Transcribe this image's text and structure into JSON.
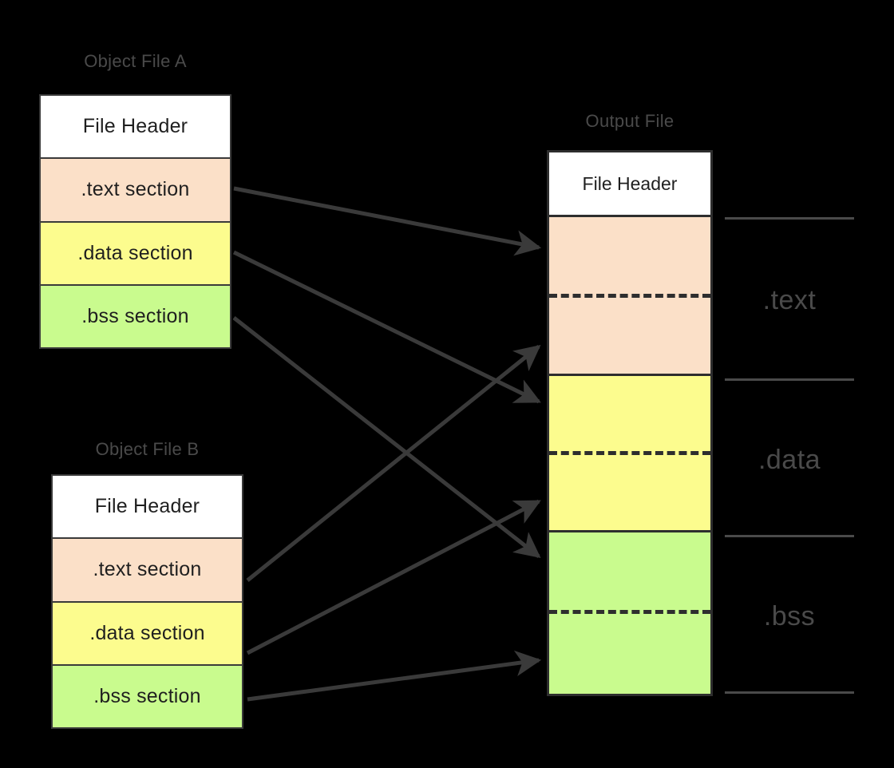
{
  "diagram": {
    "title_object_a": "Object File A",
    "title_object_b": "Object File B",
    "title_output": "Output File",
    "background_color": "#000000",
    "colors": {
      "text_section": "#fbe0c8",
      "data_section": "#fcfc8e",
      "bss_section": "#c9fb8e",
      "header_section": "#ffffff",
      "border": "#3a3a3a",
      "label_gray": "#4a4a4a",
      "body_text": "#1f1f1f"
    }
  },
  "object_file_a": {
    "label": "Object File A",
    "rows": [
      {
        "label": "File Header",
        "fill": "header"
      },
      {
        "label": ".text section",
        "fill": "text"
      },
      {
        "label": ".data section",
        "fill": "data"
      },
      {
        "label": ".bss section",
        "fill": "bss"
      }
    ]
  },
  "object_file_b": {
    "label": "Object File B",
    "rows": [
      {
        "label": "File Header",
        "fill": "header"
      },
      {
        "label": ".text section",
        "fill": "text"
      },
      {
        "label": ".data section",
        "fill": "data"
      },
      {
        "label": ".bss section",
        "fill": "bss"
      }
    ]
  },
  "output_file": {
    "label": "Output File",
    "header_label": "File Header",
    "segments": [
      {
        "name": ".text",
        "fill": "text",
        "split": true
      },
      {
        "name": ".data",
        "fill": "data",
        "split": true
      },
      {
        "name": ".bss",
        "fill": "bss",
        "split": true
      }
    ],
    "side_labels": [
      ".text",
      ".data",
      ".bss"
    ]
  },
  "arrows": [
    {
      "from": "object_file_a .text section",
      "to": "output .text upper"
    },
    {
      "from": "object_file_a .data section",
      "to": "output .data upper"
    },
    {
      "from": "object_file_a .bss section",
      "to": "output .bss upper"
    },
    {
      "from": "object_file_b .text section",
      "to": "output .text lower"
    },
    {
      "from": "object_file_b .data section",
      "to": "output .data lower"
    },
    {
      "from": "object_file_b .bss section",
      "to": "output .bss lower"
    }
  ]
}
